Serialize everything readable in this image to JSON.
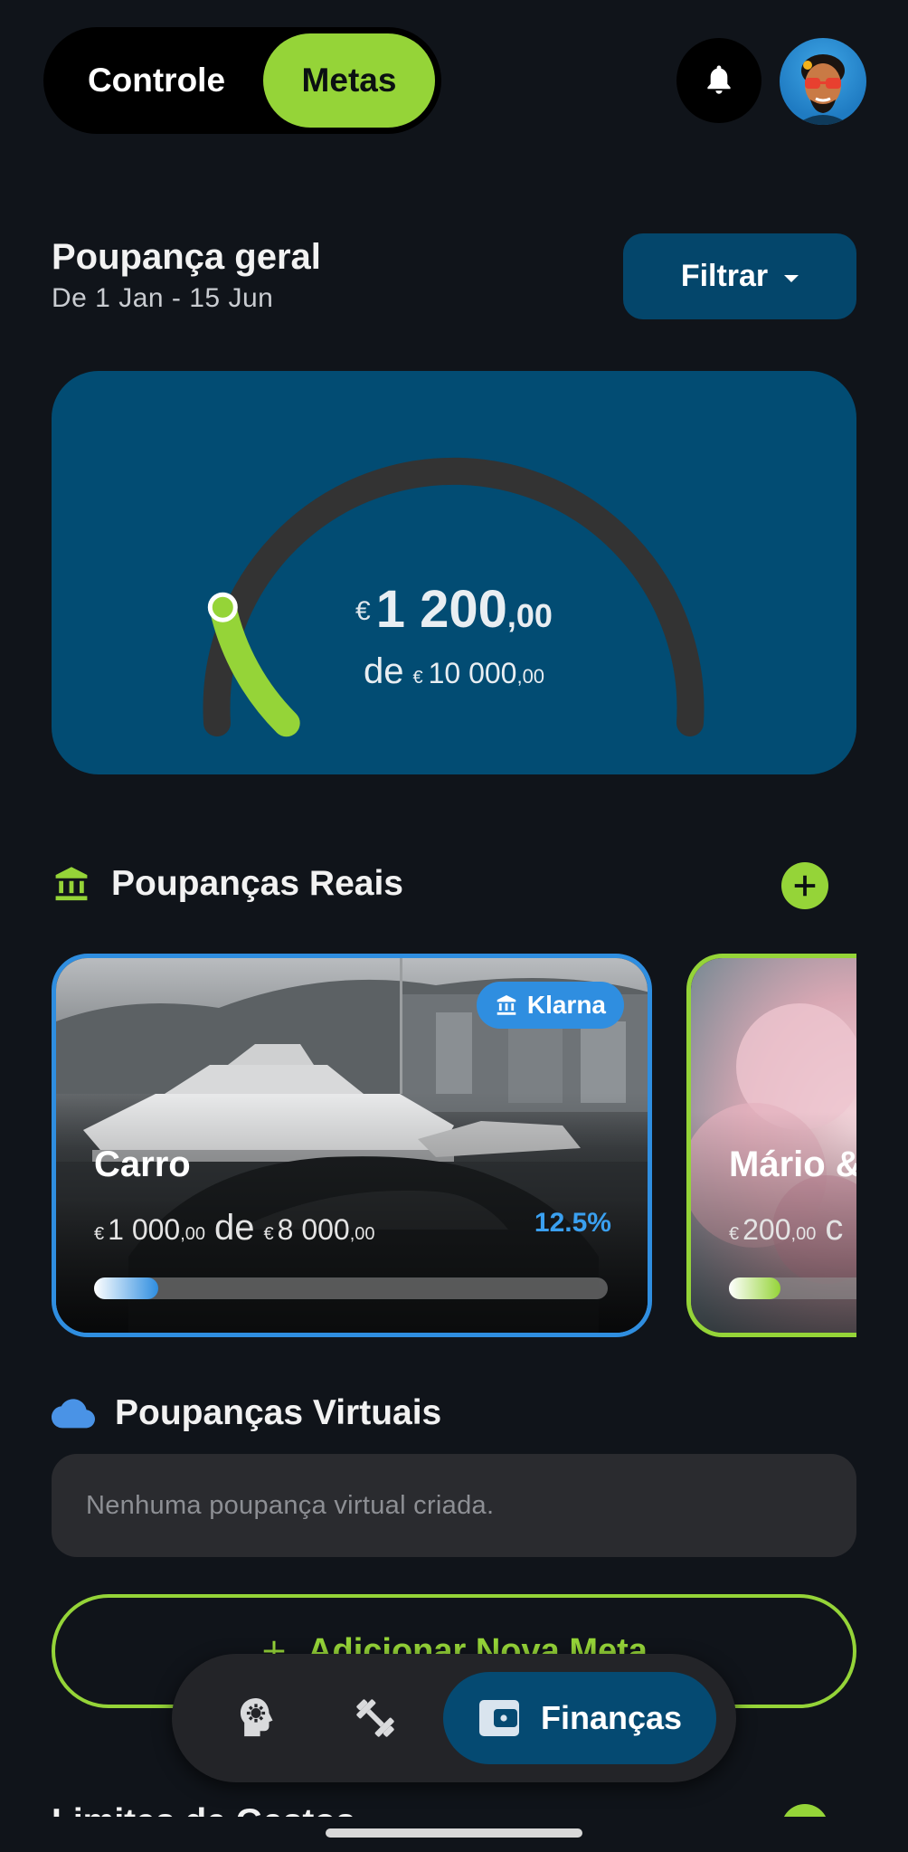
{
  "topbar": {
    "tabs": [
      {
        "label": "Controle",
        "active": false
      },
      {
        "label": "Metas",
        "active": true
      }
    ],
    "bell_icon": "bell-icon",
    "avatar": "user-avatar"
  },
  "overview": {
    "title": "Poupança geral",
    "period": "De 1 Jan - 15 Jun",
    "filter_label": "Filtrar",
    "currency": "€",
    "saved_int": "1 200",
    "saved_dec": ",00",
    "of_label": "de",
    "target_int": "10 000",
    "target_dec": ",00",
    "progress_fraction": 0.12
  },
  "real_savings": {
    "title": "Poupanças Reais",
    "icon": "bank-icon",
    "goals": [
      {
        "name": "Carro",
        "currency": "€",
        "saved_int": "1 000",
        "saved_dec": ",00",
        "of_label": "de",
        "target_int": "8 000",
        "target_dec": ",00",
        "percent": "12.5%",
        "progress_fraction": 0.125,
        "badge": "Klarna",
        "accent": "#2f8ee0"
      },
      {
        "name": "Mário &",
        "currency": "€",
        "saved_int": "200",
        "saved_dec": ",00",
        "of_label": "c",
        "accent": "#95d438",
        "progress_fraction": 0.13
      }
    ]
  },
  "virtual_savings": {
    "title": "Poupanças Virtuais",
    "icon": "cloud-icon",
    "empty_text": "Nenhuma poupança virtual criada."
  },
  "add_goal_label": "Adicionar Nova Meta",
  "next_section_title": "Limites de Gastos",
  "bottom_nav": {
    "items": [
      {
        "icon": "brain-icon"
      },
      {
        "icon": "dumbbell-icon"
      },
      {
        "icon": "wallet-icon",
        "label": "Finanças",
        "active": true
      }
    ]
  },
  "colors": {
    "background": "#10141a",
    "accent_green": "#95d438",
    "card_blue": "#024c73",
    "accent_blue": "#2f8ee0"
  }
}
